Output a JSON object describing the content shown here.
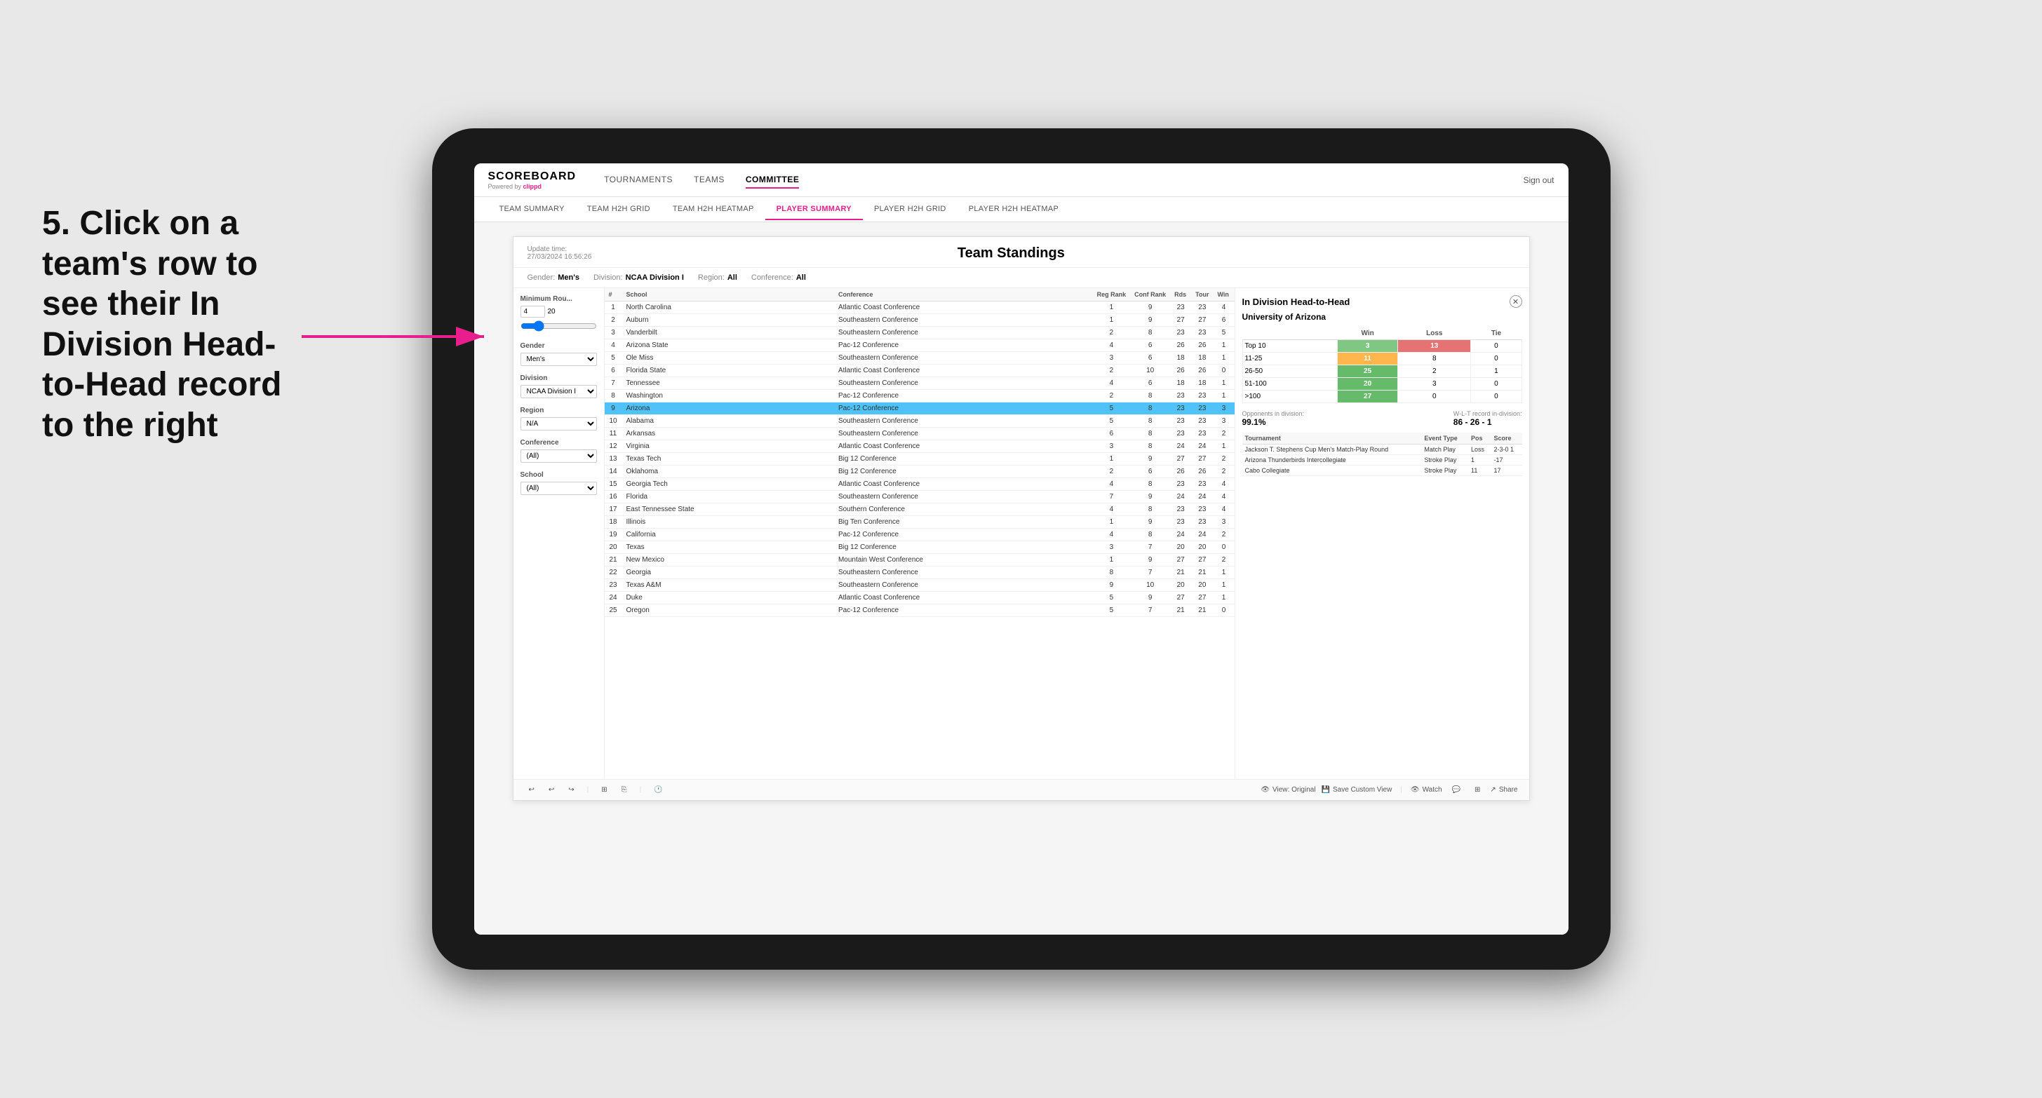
{
  "background_color": "#e0e0e0",
  "instruction": {
    "text": "5. Click on a team's row to see their In Division Head-to-Head record to the right"
  },
  "nav": {
    "logo": "SCOREBOARD",
    "powered_by": "Powered by",
    "powered_brand": "clippd",
    "links": [
      "TOURNAMENTS",
      "TEAMS",
      "COMMITTEE"
    ],
    "active_link": "COMMITTEE",
    "sign_out": "Sign out"
  },
  "sub_nav": {
    "links": [
      "TEAM SUMMARY",
      "TEAM H2H GRID",
      "TEAM H2H HEATMAP",
      "PLAYER SUMMARY",
      "PLAYER H2H GRID",
      "PLAYER H2H HEATMAP"
    ],
    "active": "PLAYER SUMMARY"
  },
  "report": {
    "title": "Team Standings",
    "update_time_label": "Update time:",
    "update_time_value": "27/03/2024 16:56:26",
    "filters": {
      "gender_label": "Gender:",
      "gender_value": "Men's",
      "division_label": "Division:",
      "division_value": "NCAA Division I",
      "region_label": "Region:",
      "region_value": "All",
      "conference_label": "Conference:",
      "conference_value": "All"
    }
  },
  "sidebar": {
    "min_rounds_label": "Minimum Rou...",
    "min_rounds_value": "4",
    "min_rounds_max": "20",
    "gender_label": "Gender",
    "gender_value": "Men's",
    "division_label": "Division",
    "division_value": "NCAA Division I",
    "region_label": "Region",
    "region_value": "N/A",
    "conference_label": "Conference",
    "conference_value": "(All)",
    "school_label": "School",
    "school_value": "(All)"
  },
  "table": {
    "headers": [
      "#",
      "School",
      "Conference",
      "Reg Rank",
      "Conf Rank",
      "Rds",
      "Tour",
      "Win"
    ],
    "rows": [
      {
        "rank": 1,
        "school": "North Carolina",
        "conference": "Atlantic Coast Conference",
        "reg_rank": 1,
        "conf_rank": 9,
        "rds": 23,
        "tour": 23,
        "win": 4,
        "selected": false
      },
      {
        "rank": 2,
        "school": "Auburn",
        "conference": "Southeastern Conference",
        "reg_rank": 1,
        "conf_rank": 9,
        "rds": 27,
        "tour": 27,
        "win": 6,
        "selected": false
      },
      {
        "rank": 3,
        "school": "Vanderbilt",
        "conference": "Southeastern Conference",
        "reg_rank": 2,
        "conf_rank": 8,
        "rds": 23,
        "tour": 23,
        "win": 5,
        "selected": false
      },
      {
        "rank": 4,
        "school": "Arizona State",
        "conference": "Pac-12 Conference",
        "reg_rank": 4,
        "conf_rank": 6,
        "rds": 26,
        "tour": 26,
        "win": 1,
        "selected": false
      },
      {
        "rank": 5,
        "school": "Ole Miss",
        "conference": "Southeastern Conference",
        "reg_rank": 3,
        "conf_rank": 6,
        "rds": 18,
        "tour": 18,
        "win": 1,
        "selected": false
      },
      {
        "rank": 6,
        "school": "Florida State",
        "conference": "Atlantic Coast Conference",
        "reg_rank": 2,
        "conf_rank": 10,
        "rds": 26,
        "tour": 26,
        "win": 0,
        "selected": false
      },
      {
        "rank": 7,
        "school": "Tennessee",
        "conference": "Southeastern Conference",
        "reg_rank": 4,
        "conf_rank": 6,
        "rds": 18,
        "tour": 18,
        "win": 1,
        "selected": false
      },
      {
        "rank": 8,
        "school": "Washington",
        "conference": "Pac-12 Conference",
        "reg_rank": 2,
        "conf_rank": 8,
        "rds": 23,
        "tour": 23,
        "win": 1,
        "selected": false
      },
      {
        "rank": 9,
        "school": "Arizona",
        "conference": "Pac-12 Conference",
        "reg_rank": 5,
        "conf_rank": 8,
        "rds": 23,
        "tour": 23,
        "win": 3,
        "selected": true
      },
      {
        "rank": 10,
        "school": "Alabama",
        "conference": "Southeastern Conference",
        "reg_rank": 5,
        "conf_rank": 8,
        "rds": 23,
        "tour": 23,
        "win": 3,
        "selected": false
      },
      {
        "rank": 11,
        "school": "Arkansas",
        "conference": "Southeastern Conference",
        "reg_rank": 6,
        "conf_rank": 8,
        "rds": 23,
        "tour": 23,
        "win": 2,
        "selected": false
      },
      {
        "rank": 12,
        "school": "Virginia",
        "conference": "Atlantic Coast Conference",
        "reg_rank": 3,
        "conf_rank": 8,
        "rds": 24,
        "tour": 24,
        "win": 1,
        "selected": false
      },
      {
        "rank": 13,
        "school": "Texas Tech",
        "conference": "Big 12 Conference",
        "reg_rank": 1,
        "conf_rank": 9,
        "rds": 27,
        "tour": 27,
        "win": 2,
        "selected": false
      },
      {
        "rank": 14,
        "school": "Oklahoma",
        "conference": "Big 12 Conference",
        "reg_rank": 2,
        "conf_rank": 6,
        "rds": 26,
        "tour": 26,
        "win": 2,
        "selected": false
      },
      {
        "rank": 15,
        "school": "Georgia Tech",
        "conference": "Atlantic Coast Conference",
        "reg_rank": 4,
        "conf_rank": 8,
        "rds": 23,
        "tour": 23,
        "win": 4,
        "selected": false
      },
      {
        "rank": 16,
        "school": "Florida",
        "conference": "Southeastern Conference",
        "reg_rank": 7,
        "conf_rank": 9,
        "rds": 24,
        "tour": 24,
        "win": 4,
        "selected": false
      },
      {
        "rank": 17,
        "school": "East Tennessee State",
        "conference": "Southern Conference",
        "reg_rank": 4,
        "conf_rank": 8,
        "rds": 23,
        "tour": 23,
        "win": 4,
        "selected": false
      },
      {
        "rank": 18,
        "school": "Illinois",
        "conference": "Big Ten Conference",
        "reg_rank": 1,
        "conf_rank": 9,
        "rds": 23,
        "tour": 23,
        "win": 3,
        "selected": false
      },
      {
        "rank": 19,
        "school": "California",
        "conference": "Pac-12 Conference",
        "reg_rank": 4,
        "conf_rank": 8,
        "rds": 24,
        "tour": 24,
        "win": 2,
        "selected": false
      },
      {
        "rank": 20,
        "school": "Texas",
        "conference": "Big 12 Conference",
        "reg_rank": 3,
        "conf_rank": 7,
        "rds": 20,
        "tour": 20,
        "win": 0,
        "selected": false
      },
      {
        "rank": 21,
        "school": "New Mexico",
        "conference": "Mountain West Conference",
        "reg_rank": 1,
        "conf_rank": 9,
        "rds": 27,
        "tour": 27,
        "win": 2,
        "selected": false
      },
      {
        "rank": 22,
        "school": "Georgia",
        "conference": "Southeastern Conference",
        "reg_rank": 8,
        "conf_rank": 7,
        "rds": 21,
        "tour": 21,
        "win": 1,
        "selected": false
      },
      {
        "rank": 23,
        "school": "Texas A&M",
        "conference": "Southeastern Conference",
        "reg_rank": 9,
        "conf_rank": 10,
        "rds": 20,
        "tour": 20,
        "win": 1,
        "selected": false
      },
      {
        "rank": 24,
        "school": "Duke",
        "conference": "Atlantic Coast Conference",
        "reg_rank": 5,
        "conf_rank": 9,
        "rds": 27,
        "tour": 27,
        "win": 1,
        "selected": false
      },
      {
        "rank": 25,
        "school": "Oregon",
        "conference": "Pac-12 Conference",
        "reg_rank": 5,
        "conf_rank": 7,
        "rds": 21,
        "tour": 21,
        "win": 0,
        "selected": false
      }
    ]
  },
  "h2h": {
    "title": "In Division Head-to-Head",
    "team_name": "University of Arizona",
    "col_headers": [
      "Win",
      "Loss",
      "Tie"
    ],
    "rows": [
      {
        "label": "Top 10",
        "win": 3,
        "loss": 13,
        "tie": 0,
        "win_color": "green",
        "loss_color": "red"
      },
      {
        "label": "11-25",
        "win": 11,
        "loss": 8,
        "tie": 0,
        "win_color": "orange",
        "loss_color": ""
      },
      {
        "label": "26-50",
        "win": 25,
        "loss": 2,
        "tie": 1,
        "win_color": "green_dark",
        "loss_color": ""
      },
      {
        "label": "51-100",
        "win": 20,
        "loss": 3,
        "tie": 0,
        "win_color": "green_dark",
        "loss_color": ""
      },
      {
        "label": ">100",
        "win": 27,
        "loss": 0,
        "tie": 0,
        "win_color": "green_dark",
        "loss_color": ""
      }
    ],
    "opponents_label": "Opponents in division:",
    "opponents_value": "99.1%",
    "wlt_label": "W-L-T record in-division:",
    "wlt_value": "86 - 26 - 1",
    "tournaments": [
      {
        "name": "Jackson T. Stephens Cup Men's Match-Play Round",
        "type": "Match Play",
        "pos": "Loss",
        "score": "2-3-0 1"
      },
      {
        "name": "Arizona Thunderbirds Intercollegiate",
        "type": "Stroke Play",
        "pos": "1",
        "score": "-17"
      },
      {
        "name": "Cabo Collegiate",
        "type": "Stroke Play",
        "pos": "11",
        "score": "17"
      }
    ]
  },
  "toolbar": {
    "undo": "↩",
    "redo": "↪",
    "view_original": "View: Original",
    "save_custom": "Save Custom View",
    "watch": "Watch",
    "share": "Share"
  }
}
